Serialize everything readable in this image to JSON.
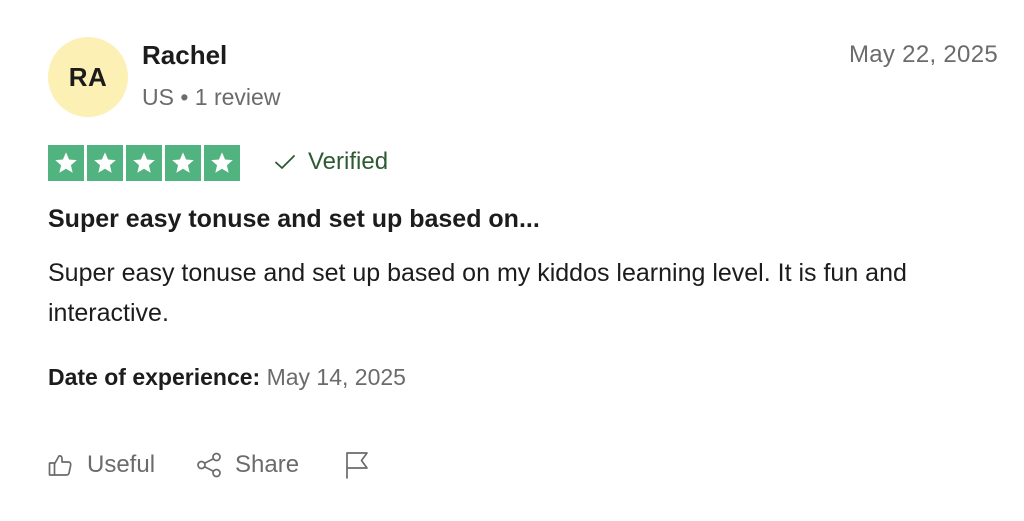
{
  "reviewer": {
    "initials": "RA",
    "name": "Rachel",
    "meta": "US • 1 review",
    "avatar_color": "#fcf0b5"
  },
  "review": {
    "date": "May 22, 2025",
    "rating": 5,
    "rating_max": 5,
    "star_color": "#51b37f",
    "verified_label": "Verified",
    "title": "Super easy tonuse and set up based on...",
    "body": "Super easy tonuse and set up based on my kiddos learning level. It is fun and interactive.",
    "experience_label": "Date of experience:",
    "experience_date": "May 14, 2025"
  },
  "actions": {
    "useful_label": "Useful",
    "share_label": "Share",
    "useful_icon": "thumbs-up-icon",
    "share_icon": "share-icon",
    "report_icon": "flag-icon"
  }
}
